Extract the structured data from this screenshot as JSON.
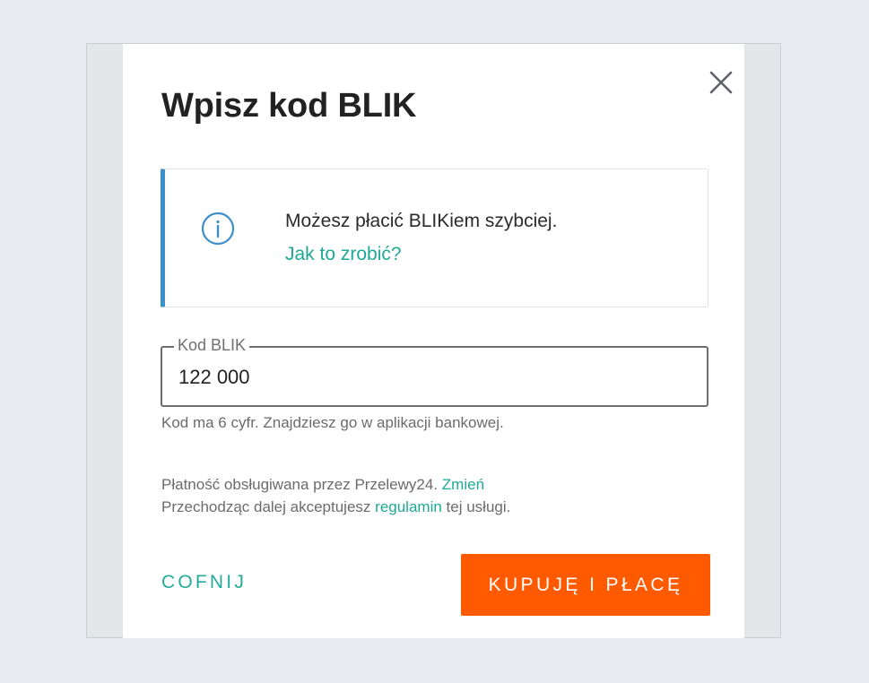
{
  "dialog": {
    "title": "Wpisz kod BLIK",
    "close_icon": "close-icon"
  },
  "info": {
    "icon": "info-icon",
    "text": "Możesz płacić BLIKiem szybciej.",
    "link": "Jak to zrobić?",
    "accent_color": "#3d8fc9"
  },
  "field": {
    "label": "Kod BLIK",
    "value": "122 000",
    "hint": "Kod ma 6 cyfr. Znajdziesz go w aplikacji bankowej."
  },
  "footer": {
    "line1_text": "Płatność obsługiwana przez Przelewy24.",
    "line1_link": "Zmień",
    "line2_prefix": "Przechodząc dalej akceptujesz",
    "line2_link": "regulamin",
    "line2_suffix": "tej usługi.",
    "link_color": "#1ea896"
  },
  "actions": {
    "back_label": "COFNIJ",
    "pay_label": "KUPUJĘ I PŁACĘ",
    "pay_color": "#ff5a00"
  }
}
